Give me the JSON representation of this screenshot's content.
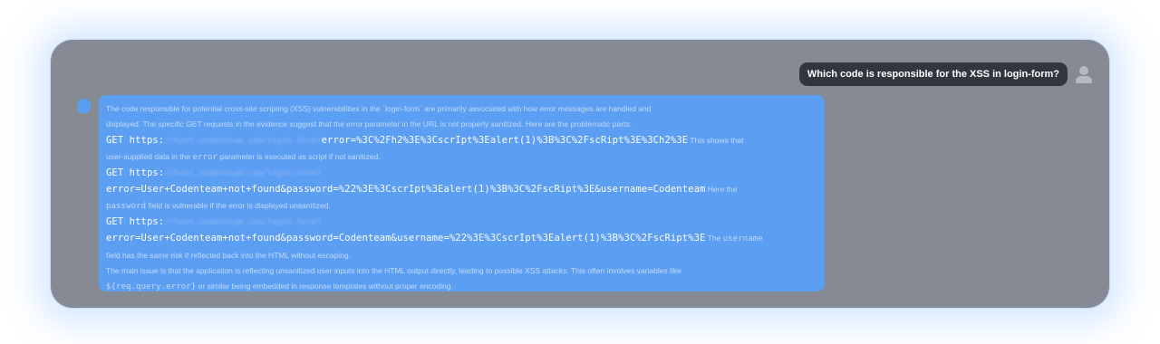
{
  "chat": {
    "user_message": "Which code is responsible for the XSS in login-form?",
    "answer": {
      "intro_1": "The code responsible for potential cross-site scripting (XSS) vulnerabilities in the `login-form` are primarily associated with how error messages are handled and",
      "intro_2": "displayed. The specific GET requests in the evidence suggest that the error parameter in the URL is not properly sanitized. Here are the problematic parts:",
      "get_prefix": "GET https:",
      "items": [
        {
          "url": "//host.codenteam.com/login-form?",
          "payload": "error=%3C%2Fh2%3E%3CscrIpt%3Ealert(1)%3B%3C%2FscRipt%3E%3Ch2%3E",
          "note_inline": " This shows that",
          "note_line": "user-supplied data in the ",
          "note_code": "error",
          "note_tail": " parameter is executed as script if not sanitized."
        },
        {
          "url": "//host.codenteam.com/login-form?",
          "payload": "error=User+Codenteam+not+found&password=%22%3E%3CscrIpt%3Ealert(1)%3B%3C%2FscRipt%3E&username=Codenteam",
          "note_inline": " Here the",
          "note_code": "password",
          "note_tail": " field is vulnerable if the error is displayed unsanitized."
        },
        {
          "url": "//host.codenteam.com/login-form?",
          "payload": "error=User+Codenteam+not+found&password=Codenteam&username=%22%3E%3CscrIpt%3Ealert(1)%3B%3C%2FscRipt%3E",
          "note_inline": " The ",
          "note_code_inline": "username",
          "note_line": "field has the same risk if reflected back into the HTML without escaping."
        }
      ],
      "summary_1": "The main issue is that the application is reflecting unsanitized user inputs into the HTML output directly, leading to possible XSS attacks. This often involves variables like",
      "summary_code": "${req.query.error}",
      "summary_2": " or similar being embedded in response templates without proper encoding."
    }
  }
}
